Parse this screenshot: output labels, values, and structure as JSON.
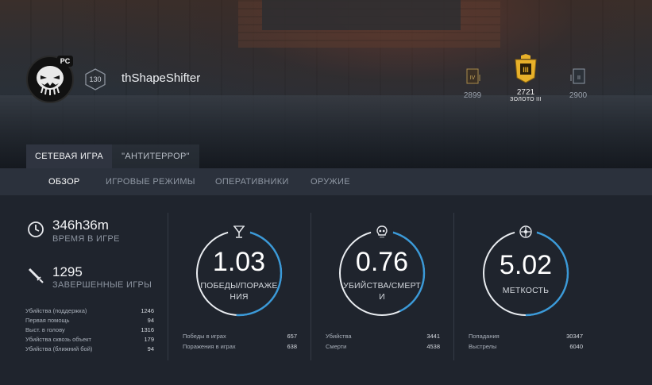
{
  "profile": {
    "platform": "PC",
    "level": "130",
    "username": "thShapeShifter"
  },
  "ranks": {
    "left": {
      "value": "2899",
      "badge": "IV"
    },
    "current": {
      "value": "2721",
      "label": "ЗОЛОТО III",
      "badge": "III"
    },
    "right": {
      "value": "2900",
      "badge": "II"
    }
  },
  "tabs": [
    {
      "label": "СЕТЕВАЯ ИГРА"
    },
    {
      "label": "\"АНТИТЕРРОР\""
    }
  ],
  "subnav": [
    {
      "label": "ОБЗОР"
    },
    {
      "label": "ИГРОВЫЕ РЕЖИМЫ"
    },
    {
      "label": "ОПЕРАТИВНИКИ"
    },
    {
      "label": "ОРУЖИЕ"
    }
  ],
  "summary": {
    "time": {
      "value": "346h36m",
      "label": "ВРЕМЯ В ИГРЕ"
    },
    "matches": {
      "value": "1295",
      "label": "ЗАВЕРШЕННЫЕ ИГРЫ"
    },
    "details": [
      {
        "key": "Убийства (поддержка)",
        "value": "1246"
      },
      {
        "key": "Первая помощь",
        "value": "94"
      },
      {
        "key": "Выст. в голову",
        "value": "1316"
      },
      {
        "key": "Убийства сквозь объект",
        "value": "179"
      },
      {
        "key": "Убийства (ближний бой)",
        "value": "94"
      }
    ]
  },
  "rings": [
    {
      "value": "1.03",
      "caption_line1": "ПОБЕДЫ/ПОРАЖЕ",
      "caption_line2": "НИЯ",
      "icon": "trophy-icon",
      "progress": 0.51,
      "rows": [
        {
          "key": "Победы в играх",
          "value": "657"
        },
        {
          "key": "Поражения в играх",
          "value": "638"
        }
      ]
    },
    {
      "value": "0.76",
      "caption_line1": "УБИЙСТВА/СМЕРТ",
      "caption_line2": "И",
      "icon": "skull-icon",
      "progress": 0.43,
      "rows": [
        {
          "key": "Убийства",
          "value": "3441"
        },
        {
          "key": "Смерти",
          "value": "4538"
        }
      ]
    },
    {
      "value": "5.02",
      "caption_line1": "МЕТКОСТЬ",
      "caption_line2": "",
      "icon": "crosshair-icon",
      "progress": 0.5,
      "rows": [
        {
          "key": "Попадания",
          "value": "30347"
        },
        {
          "key": "Выстрелы",
          "value": "6040"
        }
      ]
    }
  ],
  "colors": {
    "accent": "#3a9ad9",
    "gold": "#e8b12a"
  }
}
